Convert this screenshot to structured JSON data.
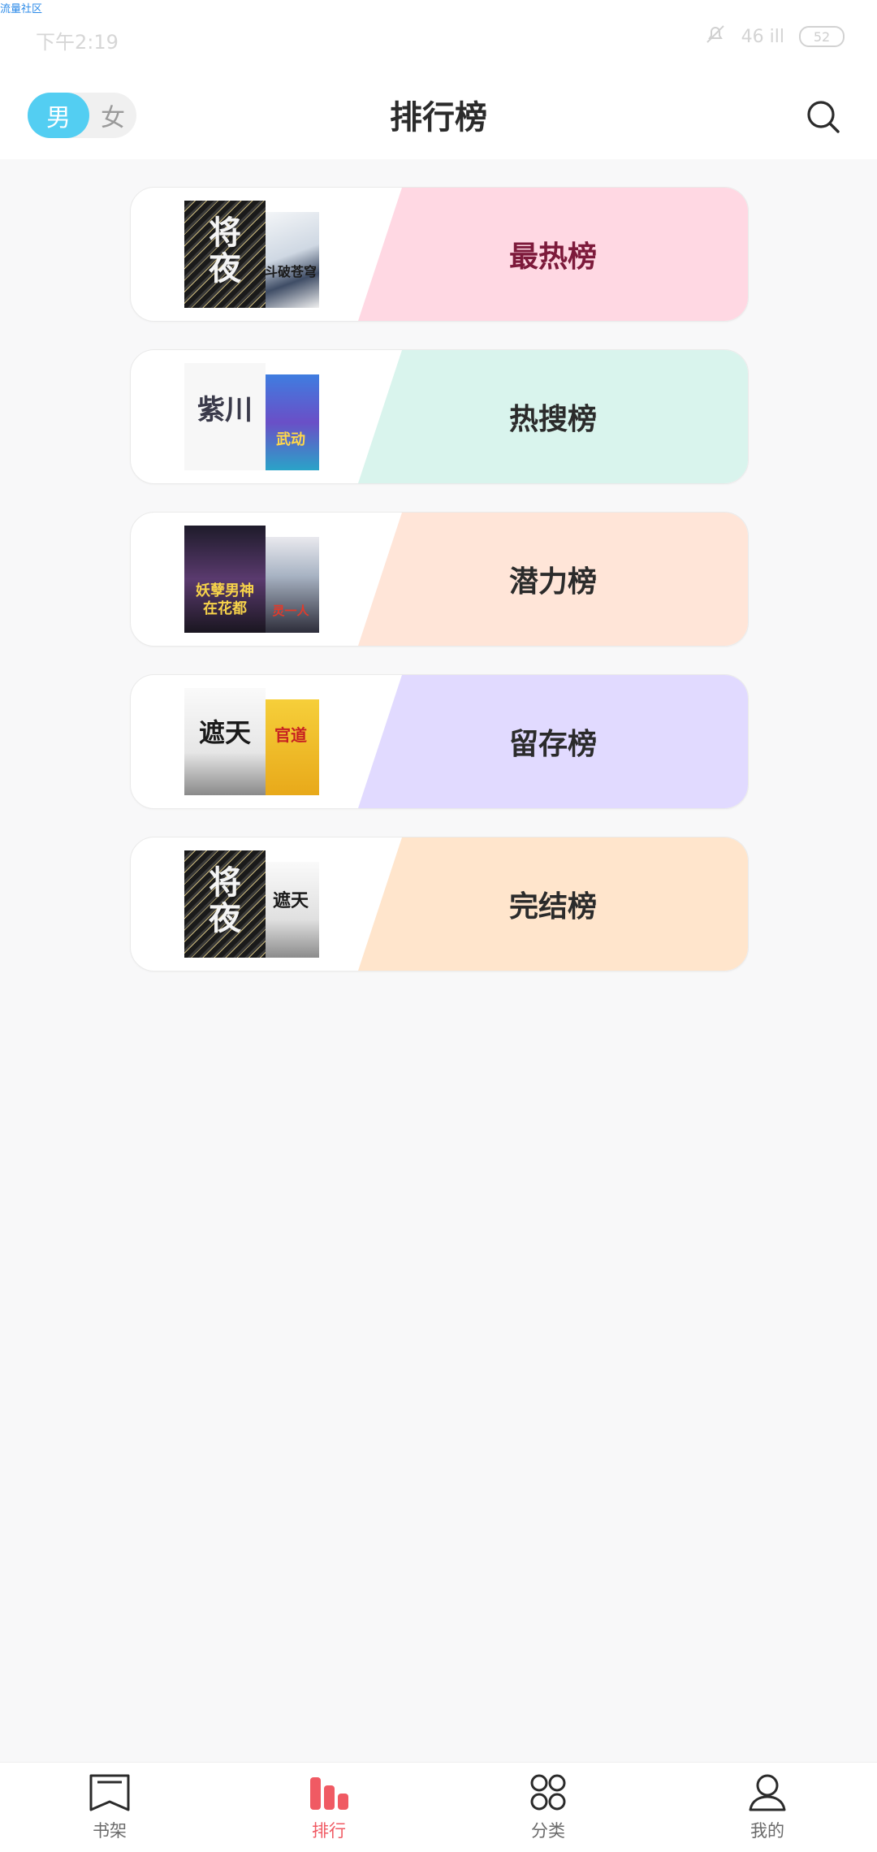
{
  "status_bar": {
    "banner": "流量社区",
    "time": "下午2:19",
    "signal_text": "46 ill",
    "battery": "52"
  },
  "header": {
    "gender_male": "男",
    "gender_female": "女",
    "title": "排行榜"
  },
  "rank_cards": [
    {
      "label": "最热榜",
      "band_color": "#ffd8e3",
      "label_color": "#7d1a3b",
      "front_cover_text": "将夜",
      "back_cover_text": "斗破苍穹"
    },
    {
      "label": "热搜榜",
      "band_color": "#d9f4ed",
      "label_color": "#2b2b2b",
      "front_cover_text": "紫川",
      "back_cover_text": "武动"
    },
    {
      "label": "潜力榜",
      "band_color": "#ffe5d8",
      "label_color": "#2b2b2b",
      "front_cover_text": "妖孽男神在花都",
      "back_cover_text": "灵一人"
    },
    {
      "label": "留存榜",
      "band_color": "#e1daff",
      "label_color": "#2b2b2b",
      "front_cover_text": "遮天",
      "back_cover_text": "官道"
    },
    {
      "label": "完结榜",
      "band_color": "#ffe5cc",
      "label_color": "#2b2b2b",
      "front_cover_text": "将夜",
      "back_cover_text": "遮天"
    }
  ],
  "bottom_nav": [
    {
      "label": "书架",
      "icon": "bookshelf-icon"
    },
    {
      "label": "排行",
      "icon": "ranking-icon",
      "active": true
    },
    {
      "label": "分类",
      "icon": "category-icon"
    },
    {
      "label": "我的",
      "icon": "profile-icon"
    }
  ],
  "colors": {
    "accent_active": "#f05a63",
    "gender_active": "#53cef2"
  }
}
